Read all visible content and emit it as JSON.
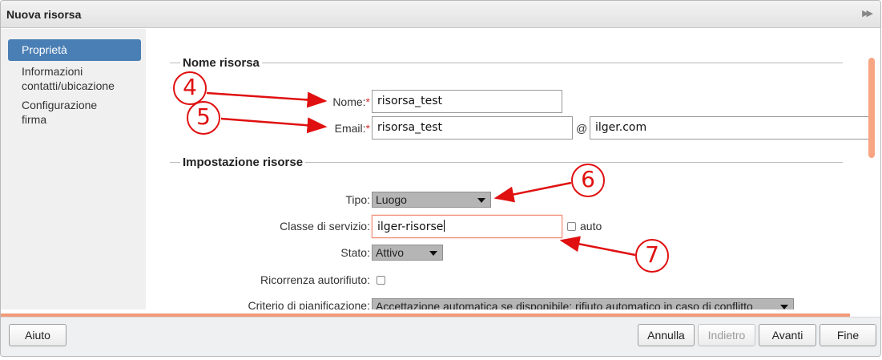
{
  "dialog": {
    "title": "Nuova risorsa"
  },
  "sidebar": {
    "items": [
      {
        "label": "Proprietà",
        "active": true
      },
      {
        "label": "Informazioni contatti/ubicazione"
      },
      {
        "label": "Configurazione firma"
      }
    ]
  },
  "sections": {
    "name": "Nome risorsa",
    "settings": "Impostazione risorse"
  },
  "form": {
    "name_label": "Nome:",
    "name_value": "risorsa_test",
    "required_mark": "*",
    "email_label": "Email:",
    "email_value": "risorsa_test",
    "at": "@",
    "domain_value": "ilger.com",
    "type_label": "Tipo:",
    "type_value": "Luogo",
    "cos_label": "Classe di servizio:",
    "cos_value": "ilger-risorse",
    "cos_auto_label": "auto",
    "status_label": "Stato:",
    "status_value": "Attivo",
    "auto_decline_label": "Ricorrenza autorifiuto:",
    "scheduling_label": "Criterio di pianificazione:",
    "scheduling_value": "Accettazione automatica se disponibile; rifiuto automatico in caso di conflitto"
  },
  "footer": {
    "help": "Aiuto",
    "cancel": "Annulla",
    "back": "Indietro",
    "next": "Avanti",
    "finish": "Fine"
  },
  "annotations": [
    "4",
    "5",
    "6",
    "7"
  ],
  "colors": {
    "accent": "#4a7fb5",
    "annotation": "#e01010",
    "focus": "#f08a72"
  }
}
